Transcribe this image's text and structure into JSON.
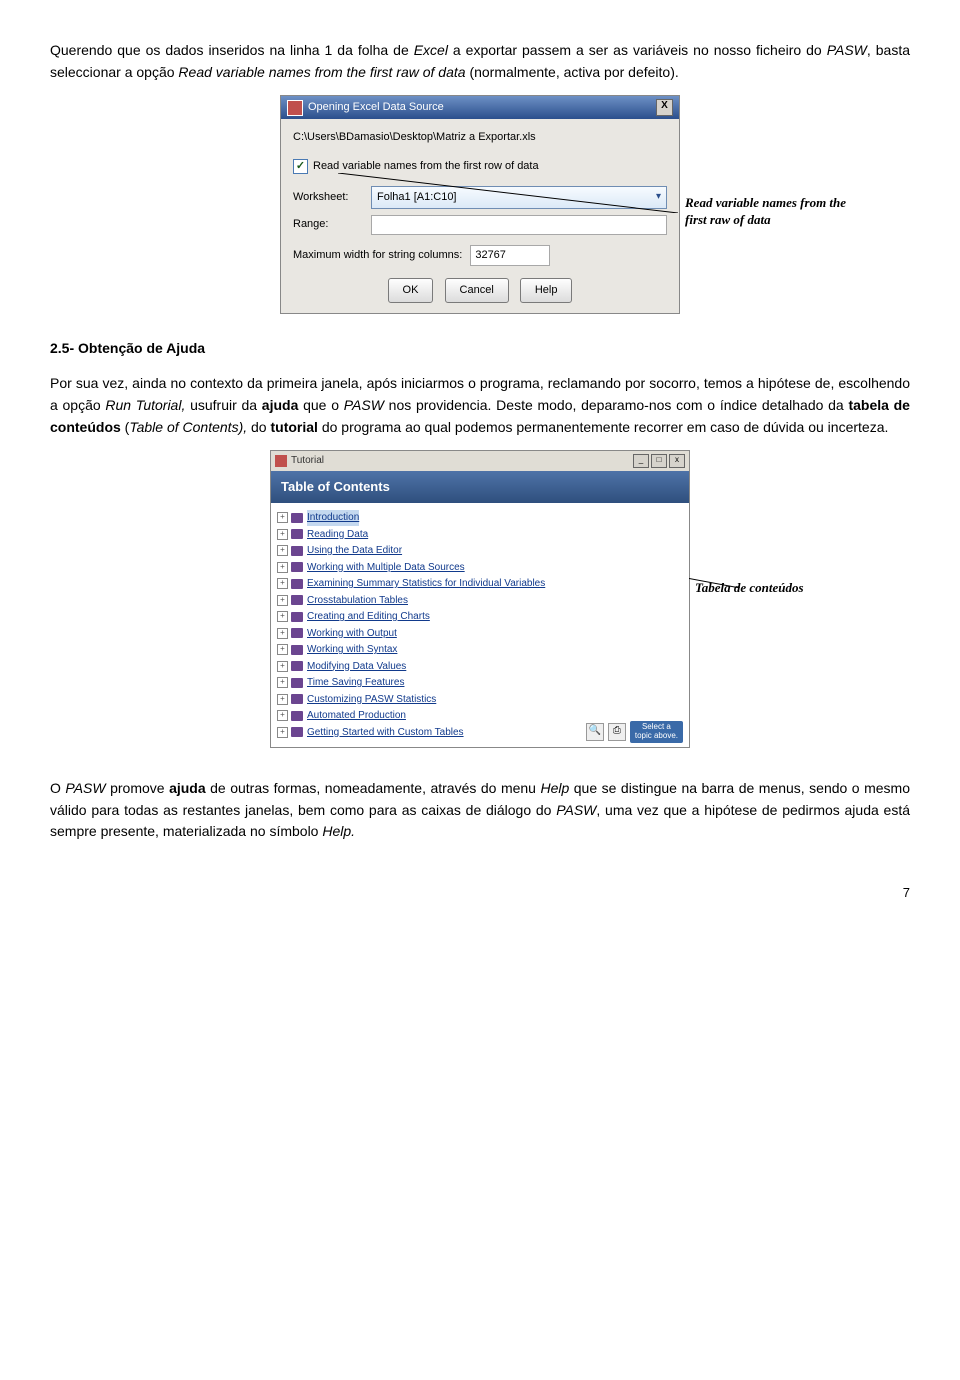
{
  "para1_a": "Querendo que os dados inseridos na linha 1 da folha de ",
  "para1_b": "Excel",
  "para1_c": " a exportar passem a ser as variáveis no nosso ficheiro do ",
  "para1_d": "PASW",
  "para1_e": ", basta seleccionar a opção ",
  "para1_f": "Read variable names from the first raw of data",
  "para1_g": " (normalmente, activa por defeito).",
  "dialog1": {
    "title": "Opening Excel Data Source",
    "close": "X",
    "path": "C:\\Users\\BDamasio\\Desktop\\Matriz a Exportar.xls",
    "chk_mark": "✓",
    "chk_label": "Read variable names from the first row of data",
    "worksheet_label": "Worksheet:",
    "worksheet_value": "Folha1 [A1:C10]",
    "range_label": "Range:",
    "max_label": "Maximum width for string columns:",
    "max_value": "32767",
    "ok": "OK",
    "cancel": "Cancel",
    "help": "Help"
  },
  "callout1_l1": "Read variable names from the",
  "callout1_l2": "first raw of data",
  "heading25": "2.5- Obtenção de Ajuda",
  "para2_a": "Por sua vez, ainda no contexto da primeira janela, após iniciarmos o programa,  reclamando por socorro, temos a hipótese de, escolhendo a opção ",
  "para2_b": "Run Tutorial,",
  "para2_c": " usufruir da ",
  "para2_d": "ajuda",
  "para2_e": " que o ",
  "para2_f": "PASW",
  "para2_g": " nos providencia. Deste modo, deparamo-nos com o índice detalhado da ",
  "para2_h": "tabela de conteúdos",
  "para2_i": " (",
  "para2_j": "Table of Contents),",
  "para2_k": " do ",
  "para2_l": "tutorial",
  "para2_m": " do programa ao qual podemos permanentemente recorrer em caso de dúvida ou incerteza.",
  "tutorial": {
    "title": "Tutorial",
    "bar": "Table of Contents",
    "items": [
      "Introduction",
      "Reading Data",
      "Using the Data Editor",
      "Working with Multiple Data Sources",
      "Examining Summary Statistics for Individual Variables",
      "Crosstabulation Tables",
      "Creating and Editing Charts",
      "Working with Output",
      "Working with Syntax",
      "Modifying Data Values",
      "Time Saving Features",
      "Customizing PASW Statistics",
      "Automated Production",
      "Getting Started with Custom Tables"
    ],
    "select_l1": "Select a",
    "select_l2": "topic above."
  },
  "callout2_text": "Tabela de conteúdos",
  "para3_a": "O ",
  "para3_b": "PASW",
  "para3_c": " promove ",
  "para3_d": "ajuda",
  "para3_e": " de outras formas, nomeadamente, através do menu ",
  "para3_f": "Help",
  "para3_g": " que se distingue na barra de menus, sendo o mesmo válido para todas as restantes janelas, bem como para as caixas de diálogo do ",
  "para3_h": "PASW",
  "para3_i": ", uma vez que a hipótese de pedirmos ajuda está sempre presente, materializada no símbolo ",
  "para3_j": "Help.",
  "page_num": "7"
}
